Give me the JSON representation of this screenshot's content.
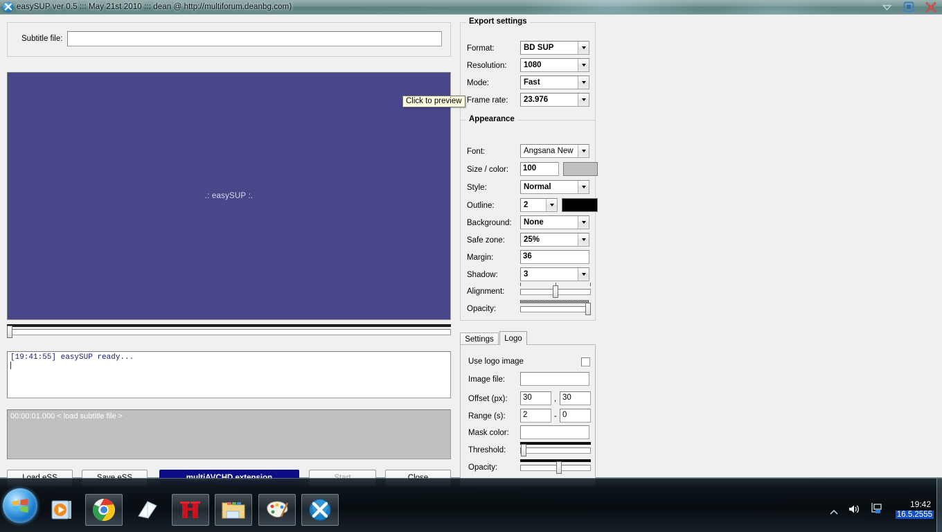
{
  "window": {
    "title": "easySUP ver 0.5 ::: May 21st 2010 ::: dean @ http://multiforum.deanbg.com)",
    "app_icon": "blue-x-icon",
    "controls": [
      {
        "name": "minimize-button",
        "glyph": "chevron-down-icon"
      },
      {
        "name": "maximize-button",
        "glyph": "square-target-icon"
      },
      {
        "name": "close-button",
        "glyph": "red-x-icon"
      }
    ]
  },
  "subtitle_bar": {
    "label": "Subtitle file:",
    "value": "",
    "placeholder": ""
  },
  "preview": {
    "text": ".: easySUP :.",
    "tooltip": "Click to preview",
    "bg_color": "#484789"
  },
  "log": {
    "lines": [
      "[19:41:55] easySUP ready..."
    ]
  },
  "subtitle_list": {
    "rows": [
      "00:00:01.000 < load subtitle file >"
    ]
  },
  "export_settings": {
    "title": "Export settings",
    "fields": [
      {
        "label": "Format:",
        "value": "BD SUP",
        "type": "combo"
      },
      {
        "label": "Resolution:",
        "value": "1080",
        "type": "combo"
      },
      {
        "label": "Mode:",
        "value": "Fast",
        "type": "combo"
      },
      {
        "label": "Frame rate:",
        "value": "23.976",
        "type": "combo"
      }
    ]
  },
  "appearance": {
    "title": "Appearance",
    "font_label": "Font:",
    "font_value": "Angsana New",
    "size_label": "Size / color:",
    "size_value": "100",
    "size_color": "#c0c0c0",
    "style_label": "Style:",
    "style_value": "Normal",
    "outline_label": "Outline:",
    "outline_value": "2",
    "outline_color": "#000000",
    "background_label": "Background:",
    "background_value": "None",
    "safezone_label": "Safe zone:",
    "safezone_value": "25%",
    "margin_label": "Margin:",
    "margin_value": "36",
    "shadow_label": "Shadow:",
    "shadow_value": "3",
    "alignment_label": "Alignment:",
    "alignment_pct": 50,
    "opacity_label": "Opacity:",
    "opacity_pct": 100
  },
  "tabs": {
    "items": [
      {
        "label": "Settings",
        "active": false
      },
      {
        "label": "Logo",
        "active": true
      }
    ]
  },
  "logo_tab": {
    "use_logo_label": "Use logo image",
    "use_logo_checked": false,
    "image_file_label": "Image file:",
    "image_file_value": "",
    "offset_label": "Offset (px):",
    "offset_x": "30",
    "offset_sep": ",",
    "offset_y": "30",
    "range_label": "Range (s):",
    "range_from": "2",
    "range_sep": "-",
    "range_to": "0",
    "mask_color_label": "Mask color:",
    "mask_color_value": "",
    "threshold_label": "Threshold:",
    "threshold_pct": 1,
    "opacity_label": "Opacity:",
    "opacity_pct": 55
  },
  "timeline": {
    "position_pct": 0
  },
  "buttons": [
    {
      "name": "load-ess-button",
      "label": "Load eSS",
      "style": "normal"
    },
    {
      "name": "save-ess-button",
      "label": "Save eSS",
      "style": "normal"
    },
    {
      "name": "multiavchd-button",
      "label": "multiAVCHD extension",
      "style": "accent"
    },
    {
      "name": "start-button",
      "label": "Start",
      "style": "disabled"
    },
    {
      "name": "close-button",
      "label": "Close",
      "style": "normal"
    }
  ],
  "taskbar": {
    "start_label": "start-orb",
    "items": [
      {
        "name": "taskbar-media-player",
        "icon": "media-player-icon",
        "framed": false
      },
      {
        "name": "taskbar-chrome",
        "icon": "chrome-icon",
        "framed": true
      },
      {
        "name": "taskbar-notepad",
        "icon": "paper-stack-icon",
        "framed": true
      },
      {
        "name": "taskbar-red-app",
        "icon": "red-ii-icon",
        "framed": true
      },
      {
        "name": "taskbar-explorer",
        "icon": "folder-icon",
        "framed": true
      },
      {
        "name": "taskbar-paint",
        "icon": "paint-palette-icon",
        "framed": true
      },
      {
        "name": "taskbar-easysup",
        "icon": "blue-x-icon",
        "framed": true
      }
    ],
    "tray": {
      "show_hidden": "chevron-up-icon",
      "volume": "speaker-icon",
      "network": "network-icon"
    },
    "clock_time": "19:42",
    "clock_date": "16.5.2555"
  }
}
